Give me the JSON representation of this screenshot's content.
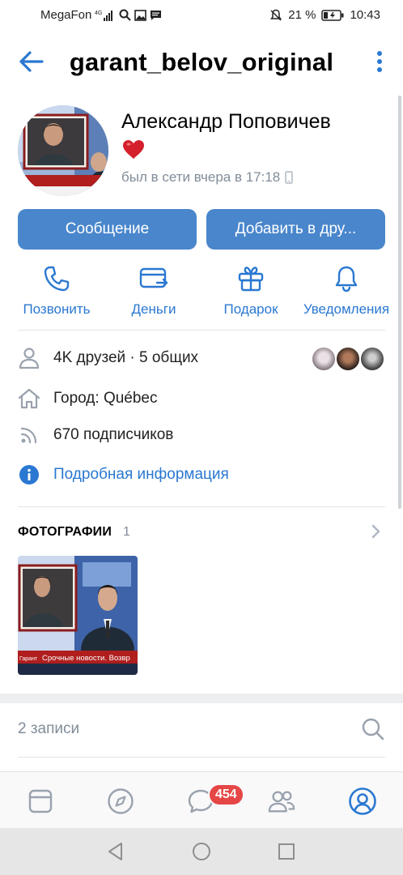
{
  "status_bar": {
    "carrier": "MegaFon",
    "network": "4G",
    "battery_percent": "21 %",
    "time": "10:43",
    "icons": [
      "signal-icon",
      "search-icon",
      "gallery-icon",
      "message-icon",
      "mute-icon",
      "battery-icon"
    ]
  },
  "header": {
    "title": "garant_belov_original"
  },
  "profile": {
    "name": "Александр Поповичев",
    "status_emoji": "heart-icon",
    "last_seen": "был в сети вчера в 17:18",
    "device_icon": "mobile-icon"
  },
  "buttons": {
    "message": "Сообщение",
    "add_friend": "Добавить в дру..."
  },
  "actions": [
    {
      "label": "Позвонить",
      "icon": "phone-icon"
    },
    {
      "label": "Деньги",
      "icon": "money-transfer-icon"
    },
    {
      "label": "Подарок",
      "icon": "gift-icon"
    },
    {
      "label": "Уведомления",
      "icon": "bell-icon"
    }
  ],
  "info": {
    "friends": "4K друзей · 5 общих",
    "city": "Город: Québec",
    "followers": "670 подписчиков",
    "details_link": "Подробная информация"
  },
  "photos": {
    "title": "ФОТОГРАФИИ",
    "count": "1",
    "thumbnail_caption": "Срочные новости. Возвр",
    "thumbnail_sidebar": "Гарант"
  },
  "posts": {
    "count_label": "2 записи"
  },
  "tabbar": {
    "items": [
      "feed-icon",
      "compass-icon",
      "messages-icon",
      "friends-icon",
      "profile-icon"
    ],
    "messages_badge": "454"
  },
  "colors": {
    "accent": "#4986cc",
    "link": "#2a78d1",
    "badge": "#e64646",
    "secondary_text": "#818c99"
  }
}
